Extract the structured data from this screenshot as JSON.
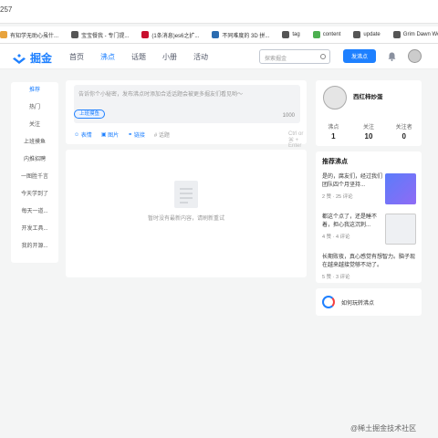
{
  "browser": {
    "url_fragment": "257",
    "bookmarks": [
      {
        "label": "有知学无助心虽什...",
        "icon": "bookmark-icon",
        "color": "#e8a33d"
      },
      {
        "label": "宝宝餐我 - 专门提...",
        "icon": "globe-icon",
        "color": "#555555"
      },
      {
        "label": "(1条消息)es6之扩...",
        "icon": "csdn-icon",
        "color": "#c8102e"
      },
      {
        "label": "不同难度的 3D 拼...",
        "icon": "page-icon",
        "color": "#2b6cb0"
      },
      {
        "label": "tag",
        "icon": "globe-icon",
        "color": "#555555"
      },
      {
        "label": "content",
        "icon": "chrome-icon",
        "color": "#4caf50"
      },
      {
        "label": "update",
        "icon": "globe-icon",
        "color": "#555555"
      },
      {
        "label": "Grim Dawn World...",
        "icon": "game-icon",
        "color": "#555555"
      }
    ]
  },
  "nav": {
    "logo_text": "掘金",
    "items": [
      "首页",
      "沸点",
      "话题",
      "小册",
      "活动"
    ],
    "active_index": 1,
    "search_placeholder": "探索掘金",
    "create_label": "发沸点"
  },
  "sidebar": {
    "items": [
      "推荐",
      "热门",
      "关注",
      "上班摸鱼",
      "内推招聘",
      "一图胜千言",
      "今天学到了",
      "每天一道...",
      "开发工具...",
      "我的开源..."
    ]
  },
  "composer": {
    "placeholder": "告诉你个小秘密，发布沸点时添加合适话题会被更多掘友们看见哟～",
    "topic_tag": "上班摸鱼",
    "counter": "1000",
    "tools": [
      "表情",
      "图片",
      "链接",
      "# 话题"
    ],
    "shortcut": "Ctrl or ⌘ + Enter",
    "publish_label": "发布"
  },
  "feed": {
    "empty_text": "暂时没有最新内容，请刷新重试"
  },
  "profile": {
    "name": "西红柿炒蛋",
    "stats": [
      {
        "label": "沸点",
        "value": "1"
      },
      {
        "label": "关注",
        "value": "10"
      },
      {
        "label": "关注者",
        "value": "0"
      }
    ]
  },
  "recommend": {
    "title": "推荐沸点",
    "items": [
      {
        "text": "是的，腐友们，经过我们团队四个月坚持...",
        "meta": "2 赞 · 25 评论"
      },
      {
        "text": "都这个点了，还是睡不着，担心我这沉刺...",
        "meta": "4 赞 · 4 评论"
      },
      {
        "text": "长期败夜，真心感觉有想智力。脑子现在越来越接觉够不动了。",
        "meta": "5 赞 · 3 评论"
      }
    ]
  },
  "howto": {
    "label": "如何玩转沸点"
  },
  "watermark": "@稀土掘金技术社区"
}
